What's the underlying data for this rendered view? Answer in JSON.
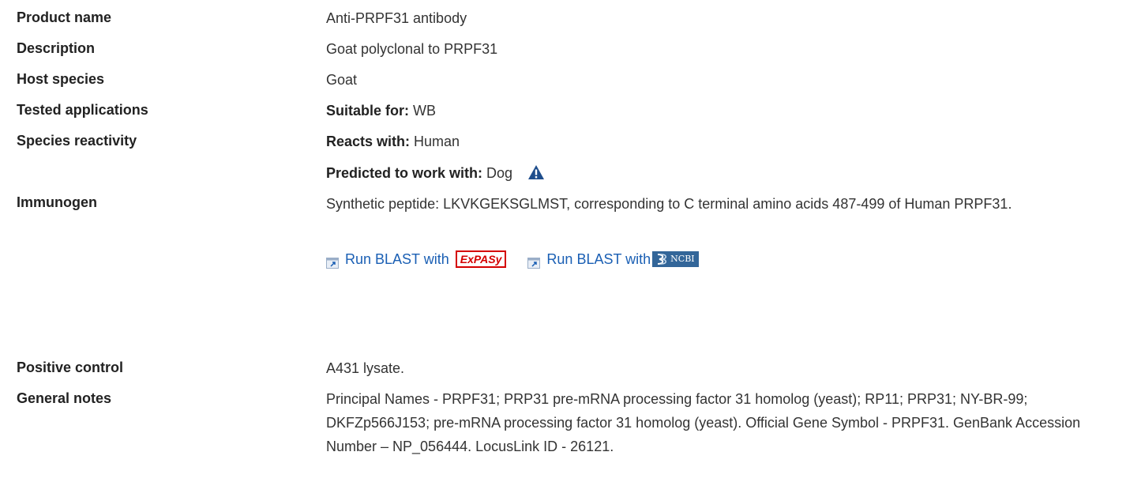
{
  "rows": {
    "product_name": {
      "label": "Product name",
      "value": "Anti-PRPF31 antibody"
    },
    "description": {
      "label": "Description",
      "value": "Goat polyclonal to PRPF31"
    },
    "host_species": {
      "label": "Host species",
      "value": "Goat"
    },
    "tested_applications": {
      "label": "Tested applications",
      "prefix": "Suitable for:",
      "value": "WB"
    },
    "species_reactivity": {
      "label": "Species reactivity",
      "reacts_prefix": "Reacts with:",
      "reacts_value": "Human",
      "predicted_prefix": "Predicted to work with:",
      "predicted_value": "Dog"
    },
    "immunogen": {
      "label": "Immunogen",
      "value": "Synthetic peptide: LKVKGEKSGLMST, corresponding to C terminal amino acids 487-499 of Human PRPF31.",
      "blast_expasy": "Run BLAST with",
      "blast_ncbi": "Run BLAST with",
      "expasy_logo_text": "ExPASy",
      "ncbi_logo_text": "NCBI"
    },
    "positive_control": {
      "label": "Positive control",
      "value": "A431 lysate."
    },
    "general_notes": {
      "label": "General notes",
      "value": "Principal Names - PRPF31; PRP31 pre-mRNA processing factor 31 homolog (yeast); RP11; PRP31; NY-BR-99; DKFZp566J153; pre-mRNA processing factor 31 homolog (yeast). Official Gene Symbol - PRPF31. GenBank Accession Number – NP_056444. LocusLink ID - 26121."
    }
  },
  "colors": {
    "link": "#1a5fb4",
    "warning_icon": "#1f4e8c",
    "expasy": "#d40000",
    "ncbi": "#336699"
  },
  "icons": {
    "warning": "warning-triangle-icon",
    "external": "external-link-icon"
  }
}
